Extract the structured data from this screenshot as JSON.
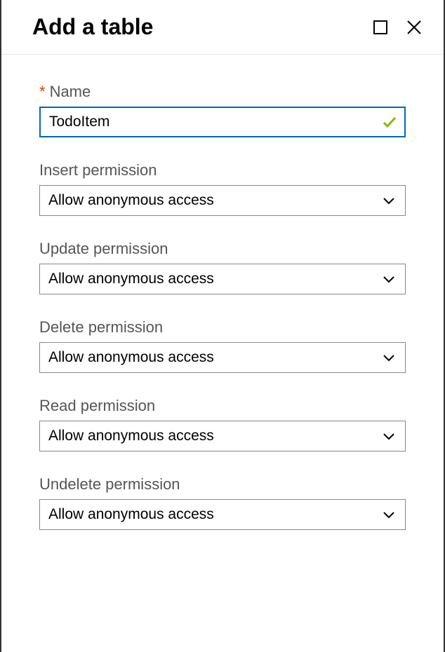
{
  "header": {
    "title": "Add a table"
  },
  "fields": {
    "name": {
      "label": "Name",
      "value": "TodoItem",
      "required_marker": "*"
    },
    "insert": {
      "label": "Insert permission",
      "value": "Allow anonymous access"
    },
    "update": {
      "label": "Update permission",
      "value": "Allow anonymous access"
    },
    "delete": {
      "label": "Delete permission",
      "value": "Allow anonymous access"
    },
    "read": {
      "label": "Read permission",
      "value": "Allow anonymous access"
    },
    "undelete": {
      "label": "Undelete permission",
      "value": "Allow anonymous access"
    }
  }
}
